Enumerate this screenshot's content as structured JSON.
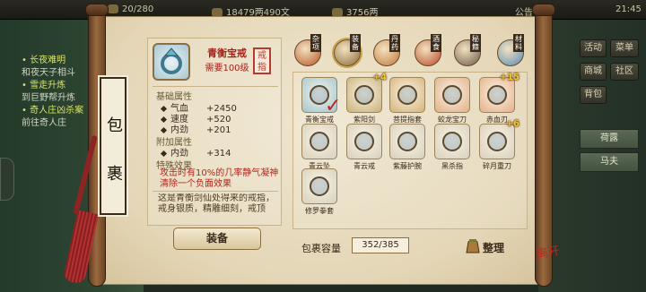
{
  "topbar": {
    "stat1": "20/280",
    "stat2": "18479两490文",
    "stat3": "3756两",
    "announce": "公告",
    "time": "21:45"
  },
  "quests": [
    {
      "text": "• 长夜难明",
      "highlight": true
    },
    {
      "text": "和夜天子相斗",
      "highlight": false
    },
    {
      "text": "• 雪走升炼",
      "highlight": true
    },
    {
      "text": "到巨野帮升炼",
      "highlight": false
    },
    {
      "text": "• 奇人庄凶杀案",
      "highlight": true
    },
    {
      "text": "前往奇人庄",
      "highlight": false
    }
  ],
  "right_menu": {
    "btn1": "活动",
    "btn2": "菜单",
    "btn3": "商城",
    "btn4": "社区",
    "btn5": "背包",
    "list1": "荷露",
    "list2": "马夫"
  },
  "panel": {
    "title_chars": [
      "包",
      "裹"
    ],
    "item_name": "青衡宝戒",
    "item_req": "需要100级",
    "seal_text": "戒指",
    "base_header": "基础属性",
    "base_stats": [
      {
        "label": "气血",
        "value": "+2450"
      },
      {
        "label": "速度",
        "value": "+520"
      },
      {
        "label": "内劲",
        "value": "+201"
      }
    ],
    "extra_header": "附加属性",
    "extra_stats": [
      {
        "label": "内劲",
        "value": "+314"
      }
    ],
    "special_header": "特殊效果",
    "special_text": "攻击时有10%的几率静气凝神清除一个负面效果",
    "flavor_text": "这是青衡剑仙处得来的戒指，戒身银质，精雕细刻，戒顶",
    "equip_label": "装备",
    "capacity_label": "包裹容量",
    "capacity_value": "352/385",
    "sort_label": "整理",
    "corner_logo": "离开"
  },
  "categories": [
    {
      "label": "杂项",
      "icon": "misc-icon",
      "color": "#b7562a"
    },
    {
      "label": "装备",
      "icon": "equipment-icon",
      "color": "#8a6a3a"
    },
    {
      "label": "丹药",
      "icon": "elixir-icon",
      "color": "#c07a3a"
    },
    {
      "label": "酒食",
      "icon": "food-icon",
      "color": "#b84a2a"
    },
    {
      "label": "秘籍",
      "icon": "manual-icon",
      "color": "#6a5a4a"
    },
    {
      "label": "材料",
      "icon": "material-icon",
      "color": "#5a8ab4"
    }
  ],
  "items": [
    {
      "name": "青衡宝戒",
      "icon": "ring-icon",
      "color": "#9fc5cf",
      "badge": ""
    },
    {
      "name": "紫阳剑",
      "icon": "sword-icon",
      "color": "#c9b07a",
      "badge": "+4"
    },
    {
      "name": "菩提指套",
      "icon": "finger-guard-icon",
      "color": "#d6b27a",
      "badge": ""
    },
    {
      "name": "蛟龙宝刀",
      "icon": "saber-icon",
      "color": "#e1b087",
      "badge": ""
    },
    {
      "name": "赤血刃",
      "icon": "blade-icon",
      "color": "#e6b08a",
      "badge": "+15"
    },
    {
      "name": "青云坠",
      "icon": "pendant-icon",
      "color": "#d9d0bc",
      "badge": ""
    },
    {
      "name": "青云戒",
      "icon": "ring-icon",
      "color": "#d9d0bc",
      "badge": ""
    },
    {
      "name": "紫藤护腕",
      "icon": "bracer-icon",
      "color": "#d9d0bc",
      "badge": ""
    },
    {
      "name": "黑杀指",
      "icon": "claw-icon",
      "color": "#d9d0bc",
      "badge": ""
    },
    {
      "name": "碎月重刀",
      "icon": "heavy-blade-icon",
      "color": "#d9d0bc",
      "badge": "+6"
    },
    {
      "name": "修罗拳套",
      "icon": "gauntlet-icon",
      "color": "#d9d0bc",
      "badge": ""
    }
  ]
}
